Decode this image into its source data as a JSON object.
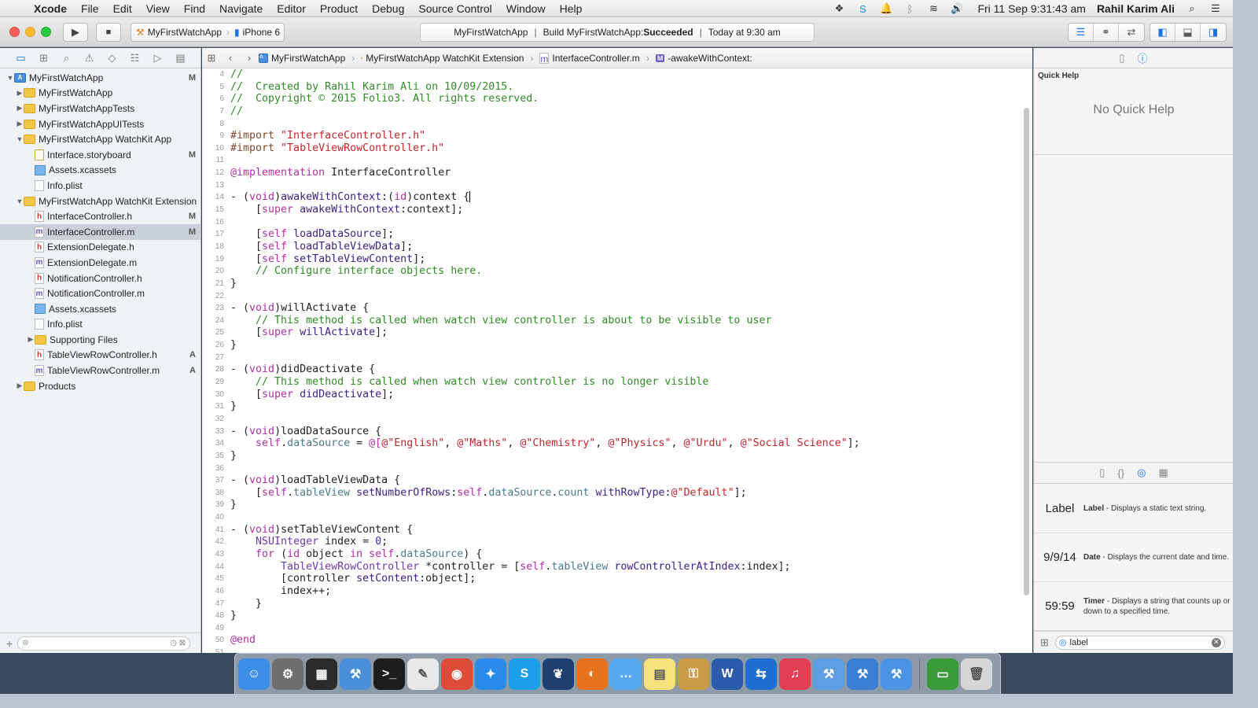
{
  "menubar": {
    "apple_icon": "apple-icon",
    "app_name": "Xcode",
    "menus": [
      "File",
      "Edit",
      "View",
      "Find",
      "Navigate",
      "Editor",
      "Product",
      "Debug",
      "Source Control",
      "Window",
      "Help"
    ],
    "clock": "Fri 11 Sep  9:31:43 am",
    "user": "Rahil Karim Ali",
    "status_icons": [
      "dropbox-icon",
      "skype-icon",
      "notification-icon",
      "bluetooth-icon",
      "wifi-icon",
      "volume-icon",
      "spotlight-icon",
      "list-icon"
    ]
  },
  "toolbar": {
    "scheme_app": "MyFirstWatchApp",
    "scheme_device": "iPhone 6",
    "activity_target": "MyFirstWatchApp",
    "activity_build_prefix": "Build MyFirstWatchApp: ",
    "activity_status": "Succeeded",
    "activity_time": "Today at 9:30 am"
  },
  "navigator": {
    "items": [
      {
        "label": "MyFirstWatchApp",
        "badge": "M"
      },
      {
        "label": "MyFirstWatchApp",
        "badge": ""
      },
      {
        "label": "MyFirstWatchAppTests",
        "badge": ""
      },
      {
        "label": "MyFirstWatchAppUITests",
        "badge": ""
      },
      {
        "label": "MyFirstWatchApp WatchKit App",
        "badge": ""
      },
      {
        "label": "Interface.storyboard",
        "badge": "M"
      },
      {
        "label": "Assets.xcassets",
        "badge": ""
      },
      {
        "label": "Info.plist",
        "badge": ""
      },
      {
        "label": "MyFirstWatchApp WatchKit Extension",
        "badge": ""
      },
      {
        "label": "InterfaceController.h",
        "badge": "M"
      },
      {
        "label": "InterfaceController.m",
        "badge": "M"
      },
      {
        "label": "ExtensionDelegate.h",
        "badge": ""
      },
      {
        "label": "ExtensionDelegate.m",
        "badge": ""
      },
      {
        "label": "NotificationController.h",
        "badge": ""
      },
      {
        "label": "NotificationController.m",
        "badge": ""
      },
      {
        "label": "Assets.xcassets",
        "badge": ""
      },
      {
        "label": "Info.plist",
        "badge": ""
      },
      {
        "label": "Supporting Files",
        "badge": ""
      },
      {
        "label": "TableViewRowController.h",
        "badge": "A"
      },
      {
        "label": "TableViewRowController.m",
        "badge": "A"
      },
      {
        "label": "Products",
        "badge": ""
      }
    ]
  },
  "jumpbar": {
    "project": "MyFirstWatchApp",
    "group": "MyFirstWatchApp WatchKit Extension",
    "file": "InterfaceController.m",
    "method": "-awakeWithContext:"
  },
  "editor": {
    "line_numbers": [
      "4",
      "5",
      "6",
      "7",
      "8",
      "9",
      "10",
      "11",
      "12",
      "13",
      "14",
      "15",
      "16",
      "17",
      "18",
      "19",
      "20",
      "21",
      "22",
      "23",
      "24",
      "25",
      "26",
      "27",
      "28",
      "29",
      "30",
      "31",
      "32",
      "33",
      "34",
      "35",
      "36",
      "37",
      "38",
      "39",
      "40",
      "41",
      "42",
      "43",
      "44",
      "45",
      "46",
      "47",
      "48",
      "49",
      "50",
      "51"
    ],
    "lines": [
      "//",
      "//  Created by Rahil Karim Ali on 10/09/2015.",
      "//  Copyright © 2015 Folio3. All rights reserved.",
      "//",
      "",
      "#import \"InterfaceController.h\"",
      "#import \"TableViewRowController.h\"",
      "",
      "@implementation InterfaceController",
      "",
      "- (void)awakeWithContext:(id)context {",
      "    [super awakeWithContext:context];",
      "",
      "    [self loadDataSource];",
      "    [self loadTableViewData];",
      "    [self setTableViewContent];",
      "    // Configure interface objects here.",
      "}",
      "",
      "- (void)willActivate {",
      "    // This method is called when watch view controller is about to be visible to user",
      "    [super willActivate];",
      "}",
      "",
      "- (void)didDeactivate {",
      "    // This method is called when watch view controller is no longer visible",
      "    [super didDeactivate];",
      "}",
      "",
      "- (void)loadDataSource {",
      "    self.dataSource = @[@\"English\", @\"Maths\", @\"Chemistry\", @\"Physics\", @\"Urdu\", @\"Social Science\"];",
      "}",
      "",
      "- (void)loadTableViewData {",
      "    [self.tableView setNumberOfRows:self.dataSource.count withRowType:@\"Default\"];",
      "}",
      "",
      "- (void)setTableViewContent {",
      "    NSUInteger index = 0;",
      "    for (id object in self.dataSource) {",
      "        TableViewRowController *controller = [self.tableView rowControllerAtIndex:index];",
      "        [controller setContent:object];",
      "        index++;",
      "    }",
      "}",
      "",
      "@end",
      ""
    ]
  },
  "utilities": {
    "quick_help_title": "Quick Help",
    "quick_help_empty": "No Quick Help",
    "library": [
      {
        "preview": "Label",
        "name": "Label",
        "desc": " - Displays a static text string."
      },
      {
        "preview": "9/9/14",
        "name": "Date",
        "desc": " - Displays the current date and time."
      },
      {
        "preview": "59:59",
        "name": "Timer",
        "desc": " - Displays a string that counts up or down to a specified time."
      }
    ],
    "filter_value": "label"
  },
  "dock": {
    "apps": [
      {
        "name": "finder-icon",
        "color": "#3c8ee6",
        "glyph": "☺"
      },
      {
        "name": "system-preferences-icon",
        "color": "#6e6e6e",
        "glyph": "⚙"
      },
      {
        "name": "app-store-icon",
        "color": "#2b2b2b",
        "glyph": "▦"
      },
      {
        "name": "xcode-icon",
        "color": "#4a8fd8",
        "glyph": "⚒"
      },
      {
        "name": "terminal-icon",
        "color": "#1d1d1d",
        "glyph": ">_"
      },
      {
        "name": "textedit-icon",
        "color": "#e9e9e9",
        "glyph": "✎"
      },
      {
        "name": "chrome-icon",
        "color": "#dd4b39",
        "glyph": "◉"
      },
      {
        "name": "safari-icon",
        "color": "#2a8bea",
        "glyph": "✦"
      },
      {
        "name": "skype-icon",
        "color": "#1aa0e8",
        "glyph": "S"
      },
      {
        "name": "sourcetree-icon",
        "color": "#1f3f6e",
        "glyph": "❦"
      },
      {
        "name": "firefox-icon",
        "color": "#e8731d",
        "glyph": "◐"
      },
      {
        "name": "messages-icon",
        "color": "#56a9ee",
        "glyph": "…"
      },
      {
        "name": "stickies-icon",
        "color": "#f6e27c",
        "glyph": "▤"
      },
      {
        "name": "keychain-icon",
        "color": "#c99a48",
        "glyph": "⚿"
      },
      {
        "name": "word-icon",
        "color": "#2c5ba9",
        "glyph": "W"
      },
      {
        "name": "teamviewer-icon",
        "color": "#1f6fd1",
        "glyph": "⇆"
      },
      {
        "name": "itunes-icon",
        "color": "#e23f55",
        "glyph": "♫"
      },
      {
        "name": "xcode-beta-icon",
        "color": "#5d9ee2",
        "glyph": "⚒"
      },
      {
        "name": "instruments-icon",
        "color": "#3a7dd2",
        "glyph": "⚒"
      },
      {
        "name": "simulator-icon",
        "color": "#4d93e4",
        "glyph": "⚒"
      }
    ],
    "trailing": [
      {
        "name": "downloads-folder-icon",
        "color": "#3a9a3a",
        "glyph": "▭"
      },
      {
        "name": "trash-icon",
        "color": "#d6d6d6",
        "glyph": "🗑"
      }
    ]
  }
}
